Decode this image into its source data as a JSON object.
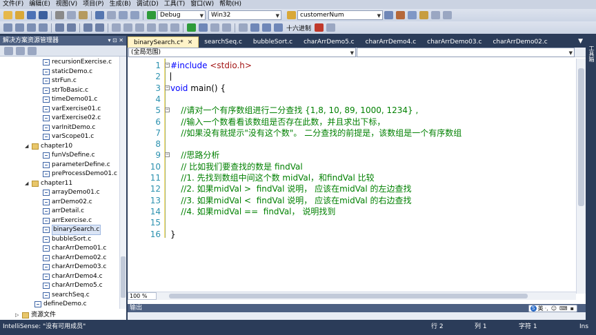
{
  "menu": [
    "文件(F)",
    "编辑(E)",
    "视图(V)",
    "项目(P)",
    "生成(B)",
    "调试(D)",
    "工具(T)",
    "窗口(W)",
    "帮助(H)"
  ],
  "toolbar": {
    "config": "Debug",
    "platform": "Win32",
    "find_value": "customerNum",
    "hex_label": "十六进制"
  },
  "solution_explorer": {
    "title": "解决方案资源管理器",
    "items": [
      {
        "label": "recursionExercise.c",
        "kind": "file",
        "level": 2
      },
      {
        "label": "staticDemo.c",
        "kind": "file",
        "level": 2
      },
      {
        "label": "strFun.c",
        "kind": "file",
        "level": 2
      },
      {
        "label": "strToBasic.c",
        "kind": "file",
        "level": 2
      },
      {
        "label": "timeDemo01.c",
        "kind": "file",
        "level": 2
      },
      {
        "label": "varExercise01.c",
        "kind": "file",
        "level": 2
      },
      {
        "label": "varExercise02.c",
        "kind": "file",
        "level": 2
      },
      {
        "label": "varInitDemo.c",
        "kind": "file",
        "level": 2
      },
      {
        "label": "varScope01.c",
        "kind": "file",
        "level": 2
      },
      {
        "label": "chapter10",
        "kind": "folder",
        "level": 1
      },
      {
        "label": "funVsDefine.c",
        "kind": "file",
        "level": 2
      },
      {
        "label": "parameterDefine.c",
        "kind": "file",
        "level": 2
      },
      {
        "label": "preProcessDemo01.c",
        "kind": "file",
        "level": 2
      },
      {
        "label": "chapter11",
        "kind": "folder",
        "level": 1
      },
      {
        "label": "arrayDemo01.c",
        "kind": "file",
        "level": 2
      },
      {
        "label": "arrDemo02.c",
        "kind": "file",
        "level": 2
      },
      {
        "label": "arrDetail.c",
        "kind": "file",
        "level": 2
      },
      {
        "label": "arrExercise.c",
        "kind": "file",
        "level": 2
      },
      {
        "label": "binarySearch.c",
        "kind": "file",
        "level": 2,
        "selected": true
      },
      {
        "label": "bubbleSort.c",
        "kind": "file",
        "level": 2
      },
      {
        "label": "charArrDemo01.c",
        "kind": "file",
        "level": 2
      },
      {
        "label": "charArrDemo02.c",
        "kind": "file",
        "level": 2
      },
      {
        "label": "charArrDemo03.c",
        "kind": "file",
        "level": 2
      },
      {
        "label": "charArrDemo4.c",
        "kind": "file",
        "level": 2
      },
      {
        "label": "charArrDemo5.c",
        "kind": "file",
        "level": 2
      },
      {
        "label": "searchSeq.c",
        "kind": "file",
        "level": 2
      },
      {
        "label": "defineDemo.c",
        "kind": "file",
        "level": 1
      }
    ],
    "bottom_node": "资源文件"
  },
  "tabs": [
    {
      "label": "binarySearch.c*",
      "active": true
    },
    {
      "label": "searchSeq.c"
    },
    {
      "label": "bubbleSort.c"
    },
    {
      "label": "charArrDemo5.c"
    },
    {
      "label": "charArrDemo4.c"
    },
    {
      "label": "charArrDemo03.c"
    },
    {
      "label": "charArrDemo02.c"
    }
  ],
  "scope_combo": "(全局范围)",
  "code_lines": [
    {
      "n": "1",
      "parts": [
        {
          "t": "#include ",
          "c": "pp"
        },
        {
          "t": "<stdio.h>",
          "c": "str"
        }
      ],
      "fold": "-"
    },
    {
      "n": "2",
      "parts": []
    },
    {
      "n": "3",
      "parts": [
        {
          "t": "void",
          "c": "kw"
        },
        {
          "t": " main() {",
          "c": ""
        }
      ],
      "fold": "-"
    },
    {
      "n": "4",
      "parts": []
    },
    {
      "n": "5",
      "parts": [
        {
          "t": "    //请对一个有序数组进行二分查找 {1,8, 10, 89, 1000, 1234} ,",
          "c": "cm"
        }
      ],
      "fold": "-"
    },
    {
      "n": "6",
      "parts": [
        {
          "t": "    //输入一个数看看该数组是否存在此数，并且求出下标，",
          "c": "cm"
        }
      ]
    },
    {
      "n": "7",
      "parts": [
        {
          "t": "    //如果没有就提示\"没有这个数\"。 二分查找的前提是，该数组是一个有序数组",
          "c": "cm"
        }
      ]
    },
    {
      "n": "8",
      "parts": []
    },
    {
      "n": "9",
      "parts": [
        {
          "t": "    //思路分析",
          "c": "cm"
        }
      ],
      "fold": "-"
    },
    {
      "n": "10",
      "parts": [
        {
          "t": "    // 比如我们要查找的数是 findVal",
          "c": "cm"
        }
      ]
    },
    {
      "n": "11",
      "parts": [
        {
          "t": "    //1. 先找到数组中间这个数 midVal，和findVal 比较",
          "c": "cm"
        }
      ]
    },
    {
      "n": "12",
      "parts": [
        {
          "t": "    //2. 如果midVal >  findVal 说明， 应该在midVal 的左边查找",
          "c": "cm"
        }
      ]
    },
    {
      "n": "13",
      "parts": [
        {
          "t": "    //3. 如果midVal <  findVal 说明， 应该在midVal 的右边查找",
          "c": "cm"
        }
      ]
    },
    {
      "n": "14",
      "parts": [
        {
          "t": "    //4. 如果midVal ==  findVal， 说明找到",
          "c": "cm"
        }
      ]
    },
    {
      "n": "15",
      "parts": []
    },
    {
      "n": "16",
      "parts": [
        {
          "t": "}",
          "c": ""
        }
      ]
    }
  ],
  "zoom": "100 %",
  "output_title": "输出",
  "ime": {
    "lang": "英"
  },
  "right_strip": "工具箱",
  "status": {
    "message": "IntelliSense: \"没有可用成员\"",
    "row": "行 2",
    "col": "列 1",
    "char": "字符 1",
    "mode": "Ins"
  }
}
